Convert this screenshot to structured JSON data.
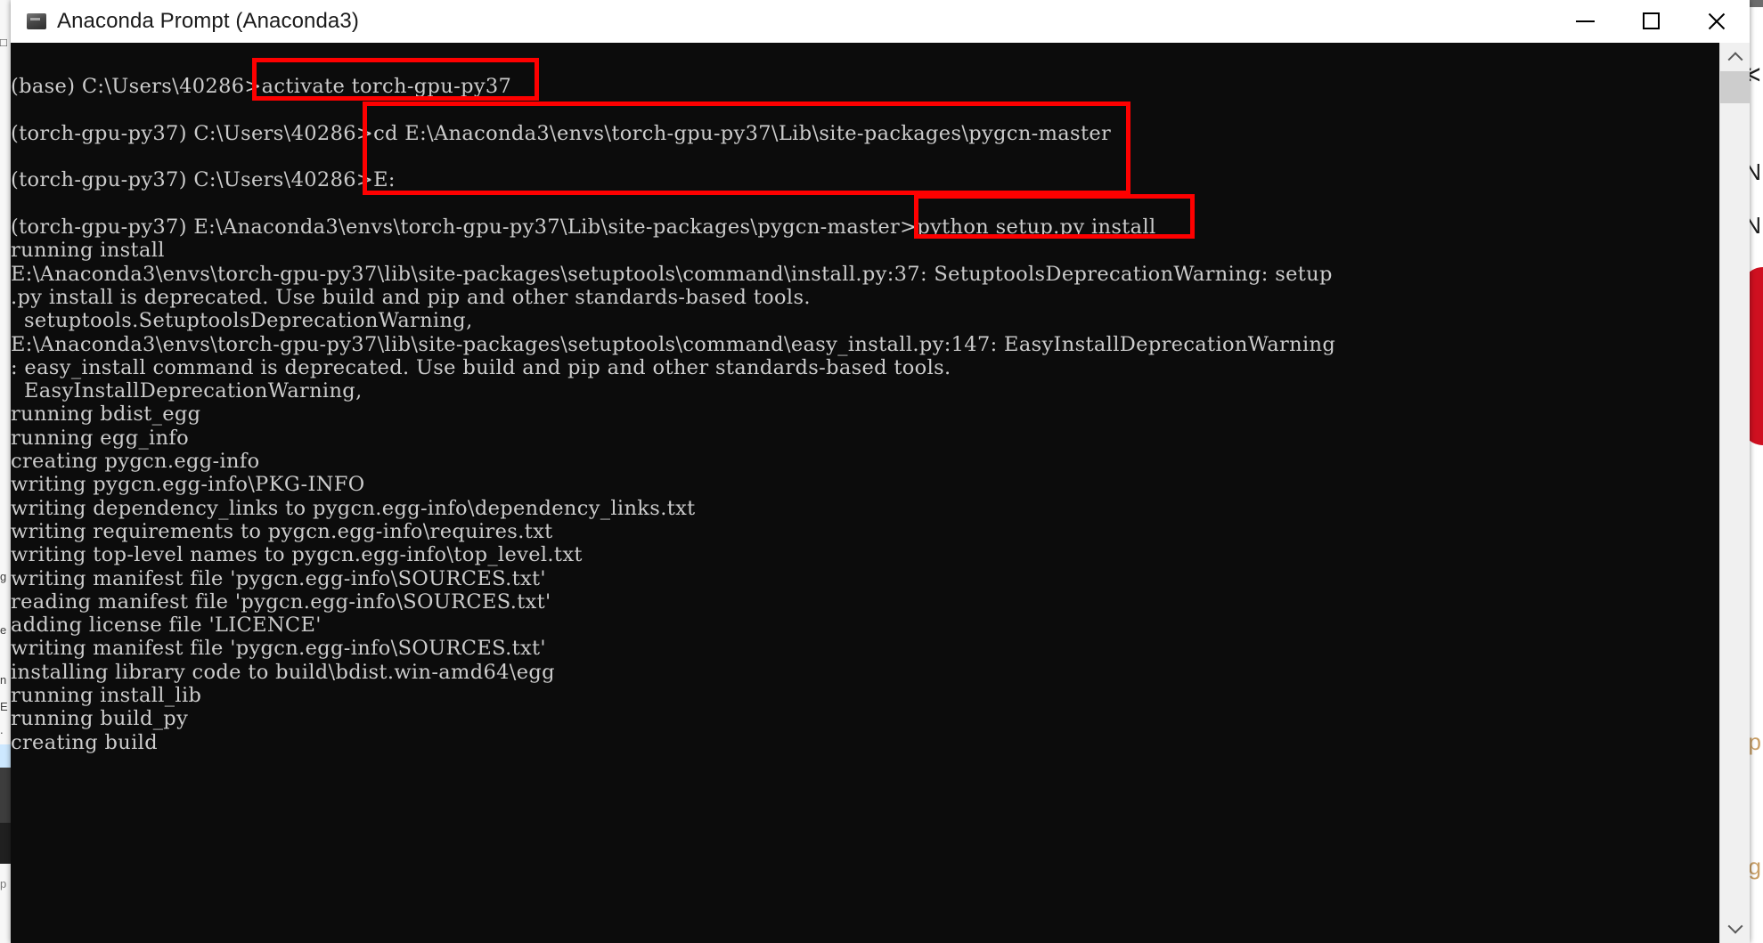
{
  "window": {
    "title": "Anaconda Prompt (Anaconda3)",
    "icon": "console-app-icon",
    "controls": {
      "minimize": "minimize-button",
      "maximize": "maximize-button",
      "close": "close-button"
    }
  },
  "colors": {
    "console_background": "#0c0c0c",
    "console_foreground": "#cccccc",
    "titlebar_background": "#ffffff",
    "annotation_red": "#fe0000",
    "scrollbar_track": "#f0f0f0",
    "scrollbar_thumb": "#cdcdcd"
  },
  "terminal": {
    "lines": [
      "",
      "(base) C:\\Users\\40286>activate torch-gpu-py37",
      "",
      "(torch-gpu-py37) C:\\Users\\40286>cd E:\\Anaconda3\\envs\\torch-gpu-py37\\Lib\\site-packages\\pygcn-master",
      "",
      "(torch-gpu-py37) C:\\Users\\40286>E:",
      "",
      "(torch-gpu-py37) E:\\Anaconda3\\envs\\torch-gpu-py37\\Lib\\site-packages\\pygcn-master>python setup.py install",
      "running install",
      "E:\\Anaconda3\\envs\\torch-gpu-py37\\lib\\site-packages\\setuptools\\command\\install.py:37: SetuptoolsDeprecationWarning: setup",
      ".py install is deprecated. Use build and pip and other standards-based tools.",
      "  setuptools.SetuptoolsDeprecationWarning,",
      "E:\\Anaconda3\\envs\\torch-gpu-py37\\lib\\site-packages\\setuptools\\command\\easy_install.py:147: EasyInstallDeprecationWarning",
      ": easy_install command is deprecated. Use build and pip and other standards-based tools.",
      "  EasyInstallDeprecationWarning,",
      "running bdist_egg",
      "running egg_info",
      "creating pygcn.egg-info",
      "writing pygcn.egg-info\\PKG-INFO",
      "writing dependency_links to pygcn.egg-info\\dependency_links.txt",
      "writing requirements to pygcn.egg-info\\requires.txt",
      "writing top-level names to pygcn.egg-info\\top_level.txt",
      "writing manifest file 'pygcn.egg-info\\SOURCES.txt'",
      "reading manifest file 'pygcn.egg-info\\SOURCES.txt'",
      "adding license file 'LICENCE'",
      "writing manifest file 'pygcn.egg-info\\SOURCES.txt'",
      "installing library code to build\\bdist.win-amd64\\egg",
      "running install_lib",
      "running build_py",
      "creating build"
    ]
  },
  "annotations": [
    {
      "label": "activate torch-gpu-py37",
      "name": "redbox-activate-command"
    },
    {
      "label": "cd E:\\Anaconda3\\envs\\torch-gpu-py37\\Lib\\site-packages\\pygcn-master  /  E:",
      "name": "redbox-cd-command"
    },
    {
      "label": "python setup.py install",
      "name": "redbox-python-setup-command"
    }
  ],
  "scrollbar": {
    "up_arrow": "scroll-up-arrow",
    "down_arrow": "scroll-down-arrow",
    "thumb": "scroll-thumb"
  },
  "background": {
    "left_strip": [
      "g",
      "e",
      "n",
      "E",
      ".",
      "r"
    ],
    "right_glyphs": [
      "N",
      "M",
      "p",
      "g"
    ]
  }
}
